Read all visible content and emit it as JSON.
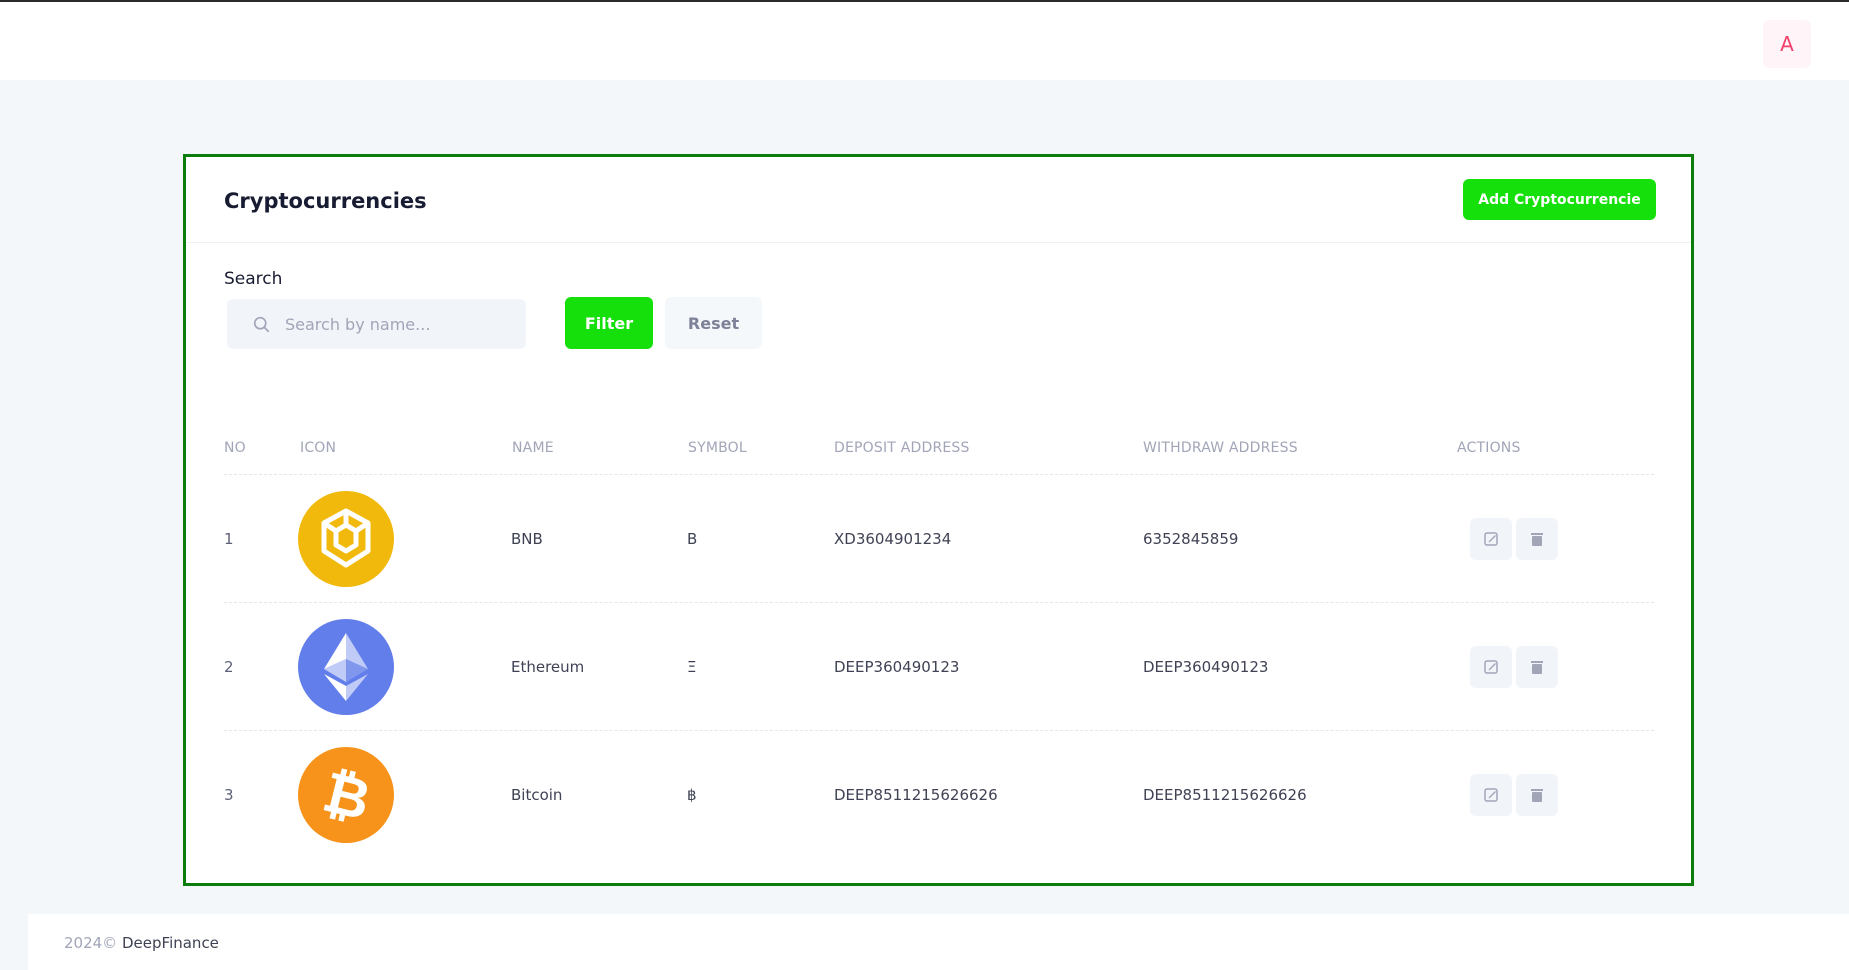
{
  "header": {
    "avatar_letter": "A"
  },
  "card": {
    "title": "Cryptocurrencies",
    "add_button_label": "Add Cryptocurrencie"
  },
  "search": {
    "label": "Search",
    "placeholder": "Search by name...",
    "value": "",
    "filter_label": "Filter",
    "reset_label": "Reset"
  },
  "table": {
    "columns": [
      "NO",
      "ICON",
      "NAME",
      "SYMBOL",
      "DEPOSIT ADDRESS",
      "WITHDRAW ADDRESS",
      "ACTIONS"
    ],
    "rows": [
      {
        "no": "1",
        "icon": "bnb-icon",
        "name": "BNB",
        "symbol": "B",
        "deposit": "XD3604901234",
        "withdraw": "6352845859"
      },
      {
        "no": "2",
        "icon": "ethereum-icon",
        "name": "Ethereum",
        "symbol": "Ξ",
        "deposit": "DEEP360490123",
        "withdraw": "DEEP360490123"
      },
      {
        "no": "3",
        "icon": "bitcoin-icon",
        "name": "Bitcoin",
        "symbol": "฿",
        "deposit": "DEEP8511215626626",
        "withdraw": "DEEP8511215626626"
      }
    ]
  },
  "footer": {
    "year": "2024©",
    "brand": "DeepFinance"
  },
  "colors": {
    "accent_green": "#16e00c",
    "card_border": "#0a7d0a",
    "bnb": "#f0b90b",
    "ethereum": "#627eea",
    "bitcoin": "#f7931a",
    "avatar_text": "#f1416c"
  }
}
